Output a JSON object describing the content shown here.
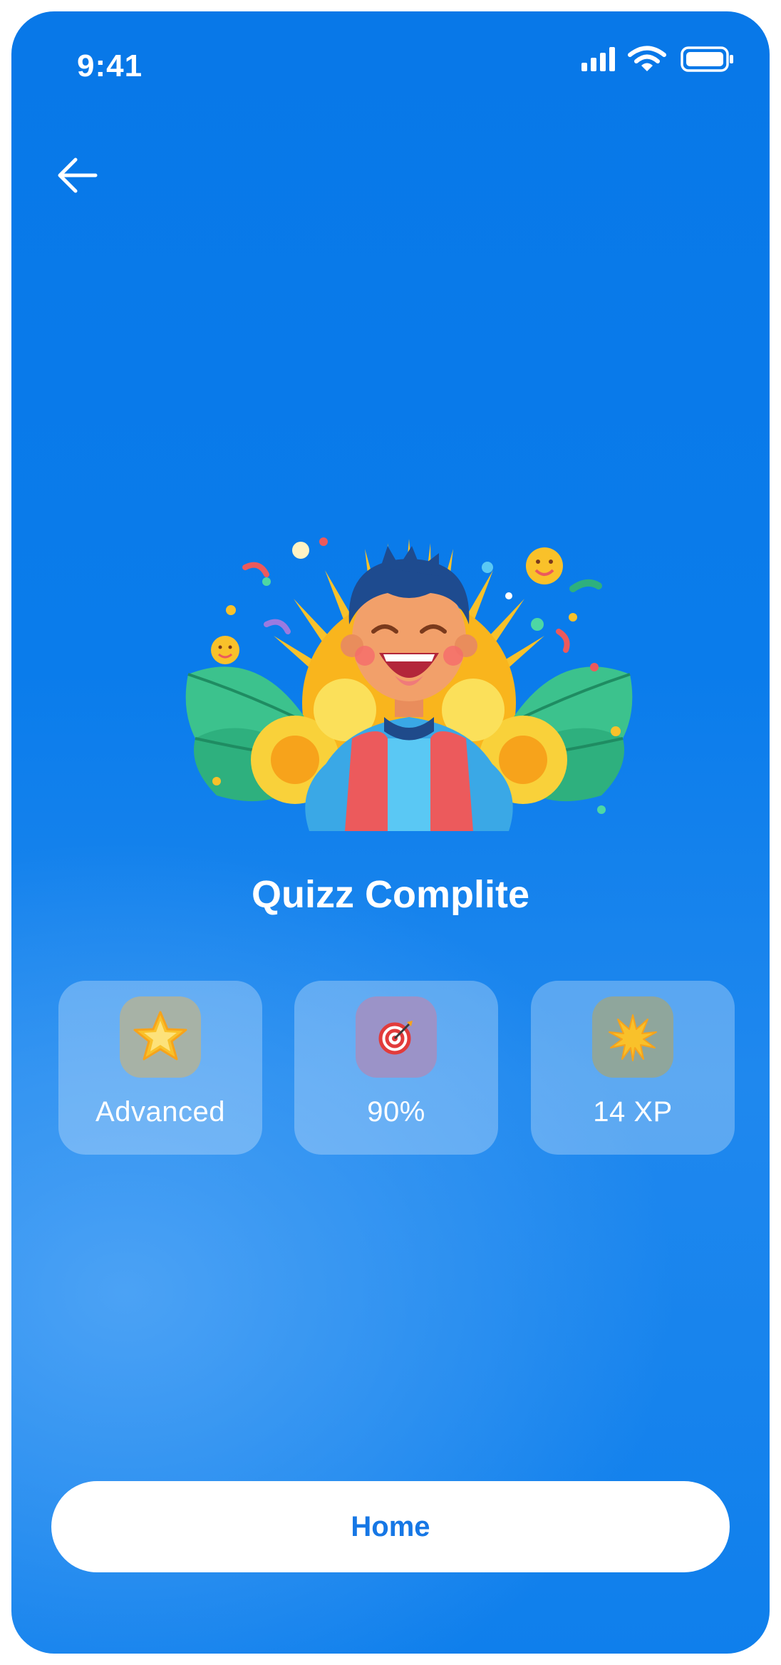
{
  "status_bar": {
    "time": "9:41"
  },
  "nav": {
    "back_icon": "arrow-left-icon"
  },
  "main": {
    "title": "Quizz Complite",
    "stats": [
      {
        "icon": "star-medal-icon",
        "label": "Advanced",
        "icon_bg": "#a7b2a6"
      },
      {
        "icon": "target-icon",
        "label": "90%",
        "icon_bg": "#9b93c8"
      },
      {
        "icon": "starburst-icon",
        "label": "14 XP",
        "icon_bg": "#8fa69c"
      }
    ]
  },
  "footer": {
    "home_label": "Home"
  },
  "colors": {
    "background": "#0a7ceb",
    "accent": "#1677e5",
    "card": "rgba(255,255,255,0.28)"
  }
}
